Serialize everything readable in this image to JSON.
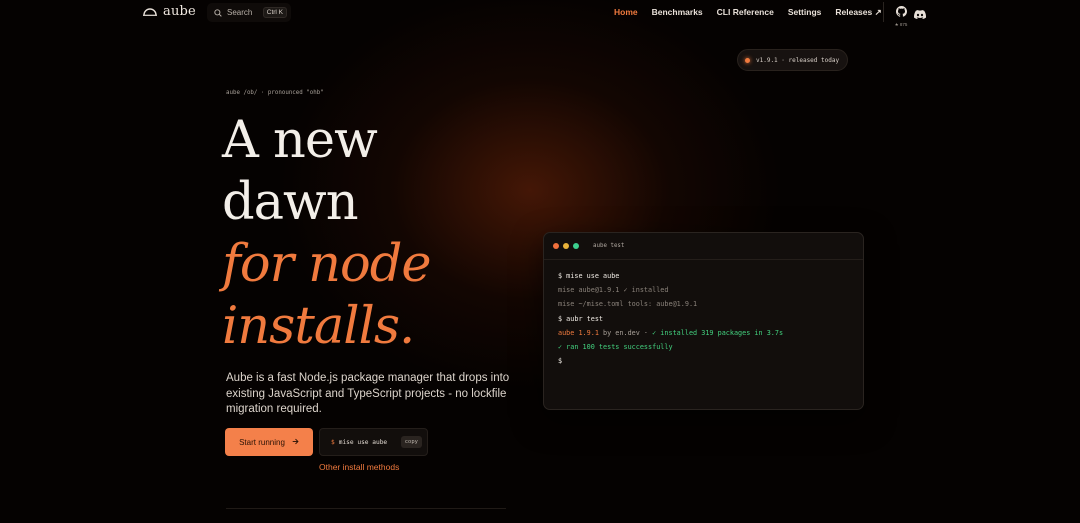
{
  "nav": {
    "brand": "aube",
    "search_label": "Search",
    "search_shortcut": "Ctrl K",
    "links": [
      {
        "label": "Home",
        "active": true
      },
      {
        "label": "Benchmarks",
        "active": false
      },
      {
        "label": "CLI Reference",
        "active": false
      },
      {
        "label": "Settings",
        "active": false
      },
      {
        "label": "Releases ↗",
        "active": false
      }
    ],
    "github_count": "★ 875"
  },
  "release_badge": "v1.9.1 · released today",
  "hero": {
    "pronunciation": "aube /ob/ · pronounced \"ohb\"",
    "headline": [
      "A new",
      "dawn",
      "for node",
      "installs."
    ],
    "description": "Aube is a fast Node.js package manager that drops into existing JavaScript and TypeScript projects - no lockfile migration required.",
    "cta_label": "Start running",
    "install_prompt": "$",
    "install_command": "mise use aube",
    "copy_label": "copy",
    "other_methods": "Other install methods"
  },
  "terminal": {
    "title": "aube test",
    "lines": [
      {
        "text": "$ mise use aube"
      },
      {
        "text": "mise aube@1.9.1 ✓ installed"
      },
      {
        "text": "mise ~/mise.toml tools: aube@1.9.1"
      },
      {
        "text": "$ aubr test"
      },
      {
        "version": "aube 1.9.1",
        "by": " by en.dev · ",
        "result": "✓ installed 319 packages in 3.7s"
      },
      {
        "text": "✓ ran 100 tests successfully"
      },
      {
        "text": "$"
      }
    ]
  },
  "colors": {
    "accent": "#f07a3e",
    "success": "#43d17f",
    "background": "#050201"
  }
}
